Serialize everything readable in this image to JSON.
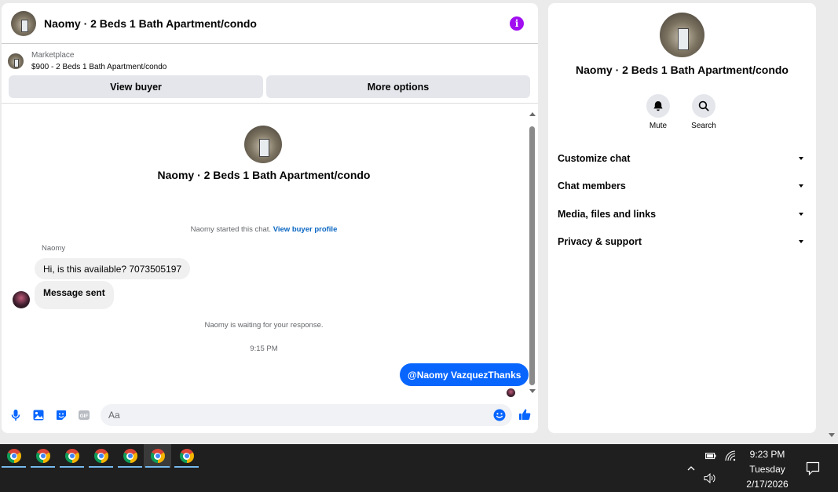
{
  "chat": {
    "title": "Naomy · 2 Beds 1 Bath Apartment/condo",
    "listing_source": "Marketplace",
    "listing_summary": "$900 - 2 Beds 1 Bath Apartment/condo",
    "view_buyer_label": "View buyer",
    "more_options_label": "More options",
    "conversation_title": "Naomy · 2 Beds 1 Bath Apartment/condo",
    "started_text": "Naomy started this chat.",
    "view_profile_link": "View buyer profile",
    "sender_name": "Naomy",
    "messages_in": [
      "Hi, is this available? 7073505197",
      "Message sent"
    ],
    "waiting_text": "Naomy is waiting for your response.",
    "timestamp": "9:15 PM",
    "message_out": "@Naomy VazquezThanks",
    "composer_placeholder": "Aa"
  },
  "info_panel": {
    "name": "Naomy · 2 Beds 1 Bath Apartment/condo",
    "mute_label": "Mute",
    "search_label": "Search",
    "menu": [
      "Customize chat",
      "Chat members",
      "Media, files and links",
      "Privacy & support"
    ]
  },
  "taskbar": {
    "apps": [
      "chrome-icon",
      "chrome-icon",
      "chrome-icon",
      "chrome-icon",
      "chrome-icon",
      "chrome-icon",
      "chrome-icon"
    ],
    "time": "9:23 PM",
    "day": "Tuesday",
    "date": "2/17/2026"
  },
  "colors": {
    "accent": "#0866ff",
    "info_icon": "#a10ef0",
    "bubble_in": "#f0f0f0"
  }
}
